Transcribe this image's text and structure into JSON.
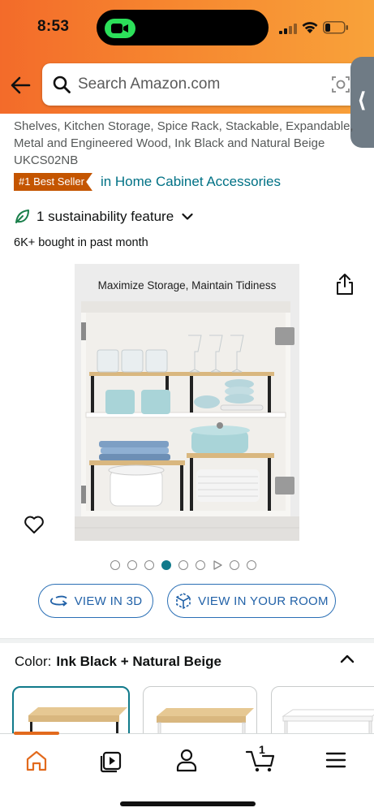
{
  "status_bar": {
    "time": "8:53"
  },
  "search": {
    "placeholder": "Search Amazon.com"
  },
  "product": {
    "title_lines": [
      "Shelves, Kitchen Storage, Spice Rack, Stackable, Expandable,",
      "Metal and Engineered Wood, Ink Black and Natural Beige",
      "UKCS02NB"
    ],
    "badge": "#1 Best Seller",
    "badge_category": "in Home Cabinet Accessories",
    "sustainability": "1 sustainability feature",
    "bought": "6K+ bought in past month",
    "image_caption": "Maximize Storage, Maintain Tidiness"
  },
  "carousel": {
    "total": 9,
    "active_index": 3,
    "video_index": 6
  },
  "buttons": {
    "view_3d": "VIEW IN 3D",
    "view_room": "VIEW IN YOUR ROOM"
  },
  "color": {
    "label": "Color:",
    "value": "Ink Black + Natural Beige"
  },
  "bottom_nav": {
    "cart_count": "1"
  },
  "colors": {
    "header_start": "#f36b2a",
    "header_end": "#f8a23a",
    "link": "#007185",
    "badge_bg": "#c45500",
    "active_teal": "#117a8b",
    "button_blue": "#2262a8",
    "nav_indicator": "#e26a1d"
  },
  "icons": [
    "facetime-icon",
    "signal-icon",
    "wifi-icon",
    "battery-icon",
    "back-arrow-icon",
    "search-icon",
    "camera-icon",
    "leaf-icon",
    "chevron-down-icon",
    "share-icon",
    "heart-icon",
    "rotate-3d-icon",
    "cube-icon",
    "chevron-up-icon",
    "home-icon",
    "inspire-icon",
    "account-icon",
    "cart-icon",
    "menu-icon"
  ]
}
